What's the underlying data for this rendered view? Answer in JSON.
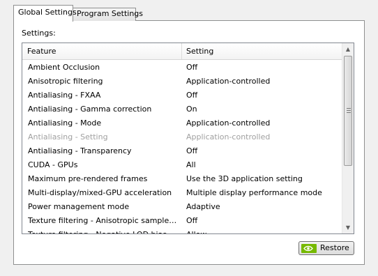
{
  "tabs": [
    {
      "label": "Global Settings",
      "active": true
    },
    {
      "label": "Program Settings",
      "active": false
    }
  ],
  "settings_label": "Settings:",
  "table": {
    "columns": [
      "Feature",
      "Setting"
    ],
    "rows": [
      {
        "feature": "Ambient Occlusion",
        "setting": "Off",
        "enabled": true
      },
      {
        "feature": "Anisotropic filtering",
        "setting": "Application-controlled",
        "enabled": true
      },
      {
        "feature": "Antialiasing - FXAA",
        "setting": "Off",
        "enabled": true
      },
      {
        "feature": "Antialiasing - Gamma correction",
        "setting": "On",
        "enabled": true
      },
      {
        "feature": "Antialiasing - Mode",
        "setting": "Application-controlled",
        "enabled": true
      },
      {
        "feature": "Antialiasing - Setting",
        "setting": "Application-controlled",
        "enabled": false
      },
      {
        "feature": "Antialiasing - Transparency",
        "setting": "Off",
        "enabled": true
      },
      {
        "feature": "CUDA - GPUs",
        "setting": "All",
        "enabled": true
      },
      {
        "feature": "Maximum pre-rendered frames",
        "setting": "Use the 3D application setting",
        "enabled": true
      },
      {
        "feature": "Multi-display/mixed-GPU acceleration",
        "setting": "Multiple display performance mode",
        "enabled": true
      },
      {
        "feature": "Power management mode",
        "setting": "Adaptive",
        "enabled": true
      },
      {
        "feature": "Texture filtering - Anisotropic sample opti...",
        "setting": "Off",
        "enabled": true
      },
      {
        "feature": "Texture filtering - Negative LOD bias",
        "setting": "Allow",
        "enabled": true
      }
    ]
  },
  "scrollbar": {
    "up_icon": "triangle-up",
    "down_icon": "triangle-down"
  },
  "restore_button": {
    "label": "Restore",
    "icon": "nvidia-logo",
    "icon_color": "#76b900"
  }
}
